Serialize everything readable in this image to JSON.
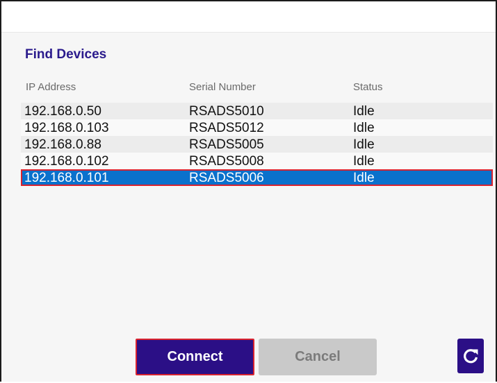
{
  "dialog": {
    "title": "Find Devices"
  },
  "columns": {
    "ip": "IP Address",
    "serial": "Serial Number",
    "status": "Status"
  },
  "devices": [
    {
      "ip": "192.168.0.50",
      "serial": "RSADS5010",
      "status": "Idle"
    },
    {
      "ip": "192.168.0.103",
      "serial": "RSADS5012",
      "status": "Idle"
    },
    {
      "ip": "192.168.0.88",
      "serial": "RSADS5005",
      "status": "Idle"
    },
    {
      "ip": "192.168.0.102",
      "serial": "RSADS5008",
      "status": "Idle"
    },
    {
      "ip": "192.168.0.101",
      "serial": "RSADS5006",
      "status": "Idle"
    }
  ],
  "selected_index": 4,
  "buttons": {
    "connect": "Connect",
    "cancel": "Cancel",
    "refresh_icon": "refresh-icon"
  },
  "colors": {
    "accent": "#2b0f86",
    "title": "#2a1a8c",
    "selection": "#0a71cc",
    "highlight_border": "#d9232f",
    "disabled": "#c9c9c9"
  }
}
